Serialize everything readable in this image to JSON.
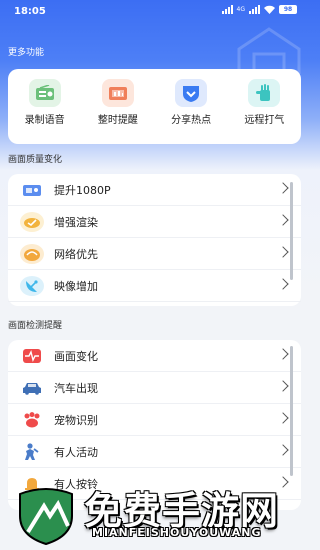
{
  "status_bar": {
    "time": "18:05",
    "network": "4G",
    "battery": "98"
  },
  "sections": {
    "more": "更多功能",
    "quality": "画面质量变化",
    "detect": "画面检测提醒"
  },
  "features": [
    {
      "label": "录制语音",
      "icon": "radio-icon",
      "color": "#6cc07a",
      "bg": "#e3f4e6"
    },
    {
      "label": "整时提醒",
      "icon": "alarm-icon",
      "color": "#f07f5a",
      "bg": "#fde6dc"
    },
    {
      "label": "分享热点",
      "icon": "hotspot-icon",
      "color": "#3a7bf2",
      "bg": "#dfe9fd"
    },
    {
      "label": "远程打气",
      "icon": "hand-icon",
      "color": "#3cc4c0",
      "bg": "#dcf5f4"
    }
  ],
  "quality_items": [
    {
      "label": "提升1080P",
      "icon": "ticket-icon",
      "color": "#5b8def"
    },
    {
      "label": "增强渲染",
      "icon": "stamp-icon",
      "color": "#f2b33d"
    },
    {
      "label": "网络优先",
      "icon": "satellite-icon",
      "color": "#f2a83d"
    },
    {
      "label": "映像增加",
      "icon": "satellite-dish-icon",
      "color": "#3fb7ea"
    }
  ],
  "detect_items": [
    {
      "label": "画面变化",
      "icon": "heartbeat-icon",
      "color": "#ef4b4b"
    },
    {
      "label": "汽车出现",
      "icon": "car-icon",
      "color": "#3f6fb5"
    },
    {
      "label": "宠物识别",
      "icon": "paw-icon",
      "color": "#ef4b4b"
    },
    {
      "label": "有人活动",
      "icon": "person-icon",
      "color": "#4a7cc9"
    },
    {
      "label": "有人按铃",
      "icon": "bell-icon",
      "color": "#f2a83d"
    }
  ],
  "watermark": {
    "title": "免费手游网",
    "subtitle": "MIANFEISHOUYOUWANG"
  }
}
